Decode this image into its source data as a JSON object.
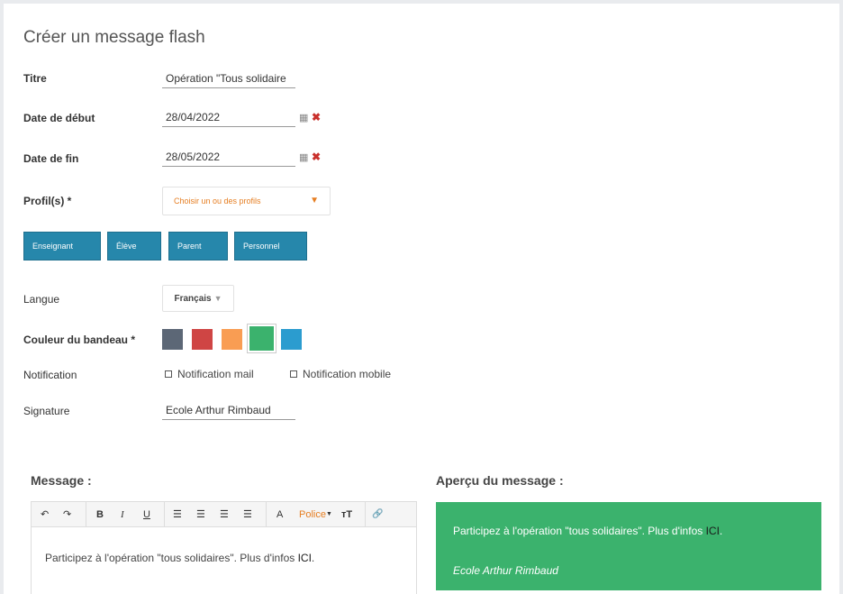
{
  "form": {
    "title": "Créer un message flash",
    "titre_label": "Titre",
    "titre_value": "Opération \"Tous solidaire",
    "start_label": "Date de début",
    "start_value": "28/04/2022",
    "end_label": "Date de fin",
    "end_value": "28/05/2022",
    "profiles_label": "Profil(s) *",
    "profiles_placeholder": "Choisir un ou des profils",
    "profile_buttons": [
      "Enseignant",
      "Élève",
      "Parent",
      "Personnel"
    ],
    "language_label": "Langue",
    "language_value": "Français",
    "color_label": "Couleur du bandeau *",
    "colors": [
      "#5c6776",
      "#cf4544",
      "#f99d53",
      "#3bb26d",
      "#2b9ccf"
    ],
    "selected_color": "#3bb26d",
    "notification_label": "Notification",
    "notif_mail": "Notification mail",
    "notif_mobile": "Notification mobile",
    "signature_label": "Signature",
    "signature_value": "Ecole Arthur Rimbaud"
  },
  "editor": {
    "section_title": "Message :",
    "toolbar": {
      "undo": "↶",
      "redo": "↷",
      "bold": "B",
      "italic": "I",
      "underline": "U",
      "font_color": "A",
      "font_label": "Police",
      "size": "тT",
      "link": "🔗"
    },
    "content_text": "Participez à l'opération \"tous solidaires\". Plus d'infos ",
    "content_link": "ICI",
    "content_end": "."
  },
  "preview": {
    "section_title": "Aperçu du message :",
    "text": "Participez à l'opération \"tous solidaires\". Plus d'infos ",
    "link": "ICI",
    "end": ".",
    "signature": "Ecole Arthur Rimbaud"
  }
}
